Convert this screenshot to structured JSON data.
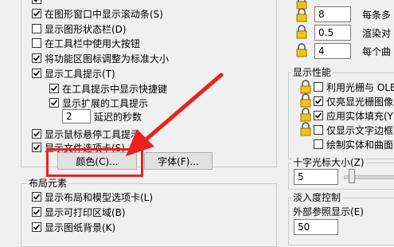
{
  "left": {
    "display_options": [
      {
        "label": "在图形窗口中显示滚动条(S)",
        "checked": true
      },
      {
        "label": "显示图形状态栏(D)",
        "checked": false
      },
      {
        "label": "在工具栏中使用大按钮",
        "checked": false
      },
      {
        "label": "将功能区图标调整为标准大小",
        "checked": true
      },
      {
        "label": "显示工具提示(T)",
        "checked": true
      },
      {
        "label": "在工具提示中显示快捷键",
        "checked": true
      },
      {
        "label": "显示扩展的工具提示",
        "checked": true
      }
    ],
    "delay_value": "2",
    "delay_label": "延迟的秒数",
    "hover_label": "显示鼠标悬停工具提示",
    "hover_checked": true,
    "file_tabs_label": "显示文件选项卡(S)",
    "file_tabs_checked": true,
    "colors_button": "颜色(C)...",
    "fonts_button": "字体(F)...",
    "layout_group_title": "布局元素",
    "layout_options": [
      {
        "label": "显示布局和模型选项卡(L)",
        "checked": true
      },
      {
        "label": "显示可打印区域(B)",
        "checked": true
      },
      {
        "label": "显示图纸背景(K)",
        "checked": true
      }
    ]
  },
  "right": {
    "resolution_rows": [
      {
        "value": "8",
        "label": "每条多"
      },
      {
        "value": "0.5",
        "label": "渲染对"
      },
      {
        "value": "4",
        "label": "每个曲"
      }
    ],
    "performance_title": "显示性能",
    "performance_options": [
      {
        "label": "利用光栅与 OLE",
        "checked": false
      },
      {
        "label": "仅亮显光栅图像",
        "checked": true
      },
      {
        "label": "应用实体填充(Y)",
        "checked": true
      },
      {
        "label": "仅显示文字边框",
        "checked": false
      },
      {
        "label": "绘制实体和曲面",
        "checked": false
      }
    ],
    "crosshair_title": "十字光标大小(Z)",
    "crosshair_value": "5",
    "fade_title": "淡入度控制",
    "xref_label": "外部参照显示(E)",
    "xref_value": "50"
  },
  "annotation_color": "#e8231d"
}
